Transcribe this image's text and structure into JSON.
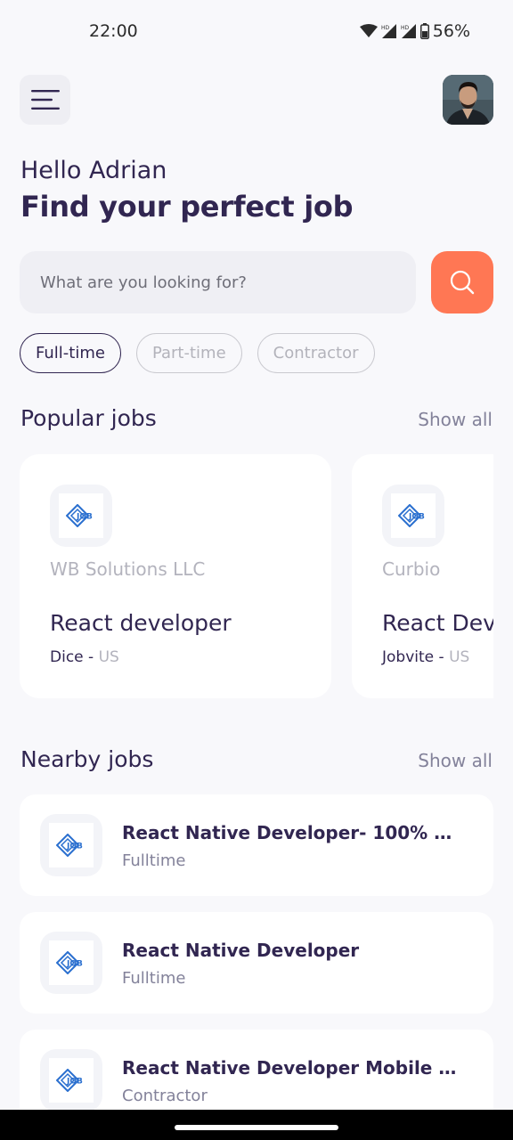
{
  "status_bar": {
    "time": "22:00",
    "battery": "56%"
  },
  "header": {
    "menu_icon": "menu-icon",
    "avatar_icon": "profile-avatar"
  },
  "welcome": {
    "greeting": "Hello Adrian",
    "headline": "Find your perfect job"
  },
  "search": {
    "placeholder": "What are you looking for?",
    "value": "",
    "button_icon": "search-icon"
  },
  "job_type_tabs": [
    {
      "label": "Full-time",
      "active": true
    },
    {
      "label": "Part-time",
      "active": false
    },
    {
      "label": "Contractor",
      "active": false
    }
  ],
  "popular": {
    "title": "Popular jobs",
    "show_all": "Show all",
    "cards": [
      {
        "company": "WB Solutions LLC",
        "title": "React developer",
        "publisher": "Dice",
        "country": "US",
        "logo_text": "JOB"
      },
      {
        "company": "Curbio",
        "title": "React Developer",
        "publisher": "Jobvite",
        "country": "US",
        "logo_text": "JOB"
      }
    ]
  },
  "nearby": {
    "title": "Nearby jobs",
    "show_all": "Show all",
    "items": [
      {
        "title": "React Native Developer- 100% R...",
        "type": "Fulltime",
        "logo_text": "JOB"
      },
      {
        "title": "React Native Developer",
        "type": "Fulltime",
        "logo_text": "JOB"
      },
      {
        "title": "React Native Developer Mobile D...",
        "type": "Contractor",
        "logo_text": "JOB"
      }
    ]
  },
  "colors": {
    "primary": "#312651",
    "accent": "#ff7754",
    "gray": "#83829a",
    "background": "#f8f8fb"
  },
  "separator": " - "
}
